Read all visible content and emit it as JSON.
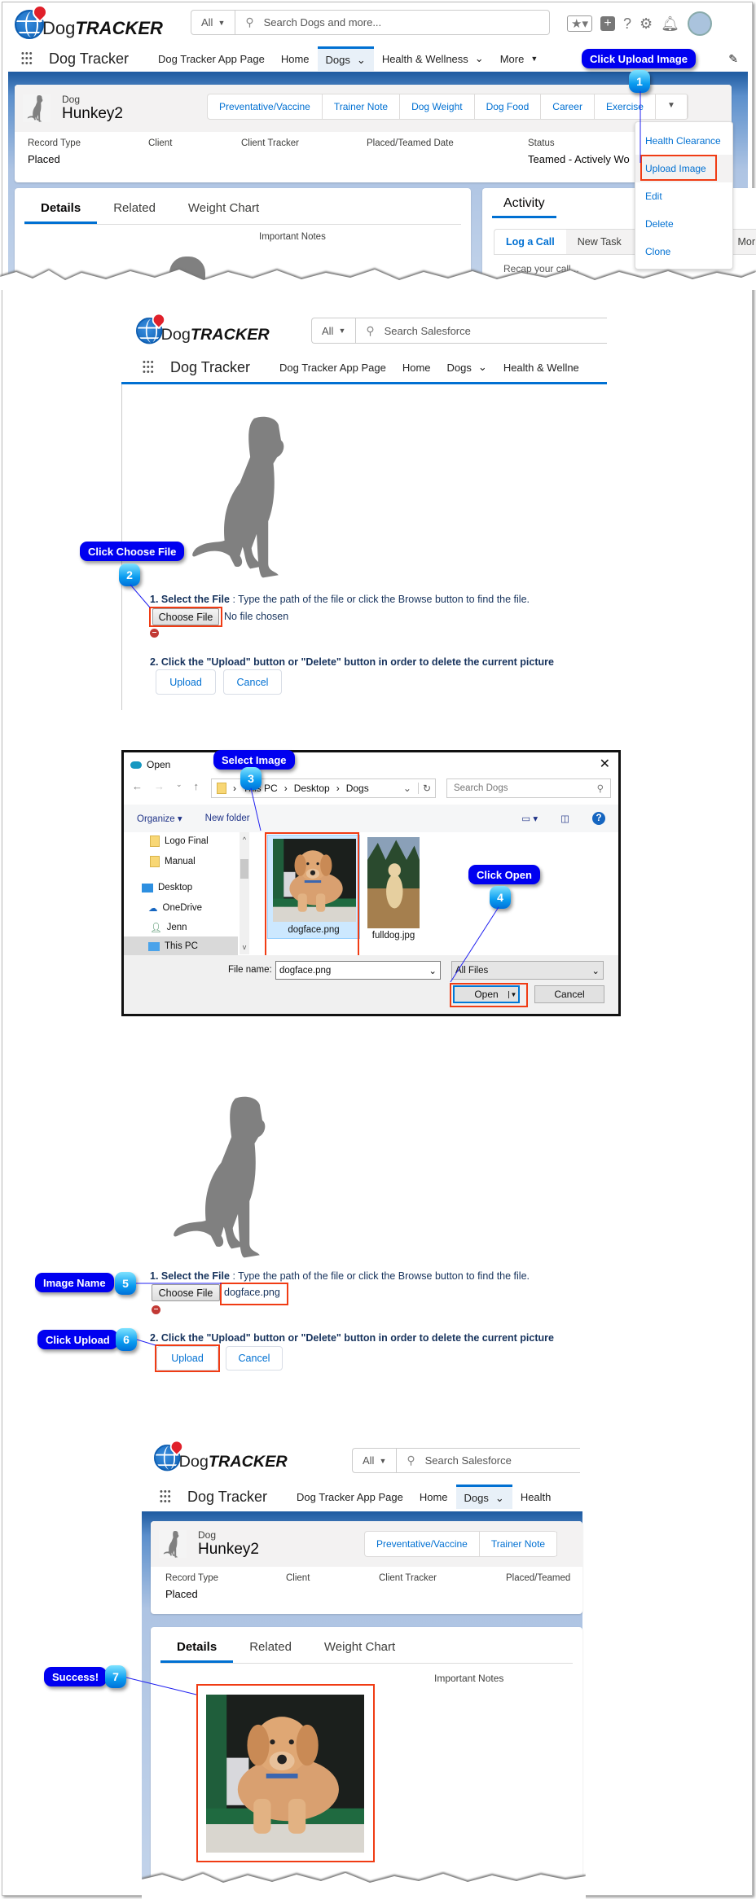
{
  "app": {
    "logo_text_1": "Dog",
    "logo_text_2": "TRACKER",
    "app_name": "Dog Tracker",
    "search_scope": "All",
    "search_placeholder_1": "Search Dogs and more...",
    "search_placeholder_2": "Search Salesforce",
    "nav_items": [
      "Dog Tracker App Page",
      "Home",
      "Dogs",
      "Health & Wellness",
      "More"
    ],
    "nav_item_truncated_2": "Health & Wellne",
    "nav_item_truncated_5": "Health"
  },
  "record": {
    "object_label": "Dog",
    "name": "Hunkey2",
    "actions": [
      "Preventative/Vaccine",
      "Trainer Note",
      "Dog Weight",
      "Dog Food",
      "Career",
      "Exercise"
    ],
    "fields": [
      {
        "label": "Record Type",
        "value": "Placed"
      },
      {
        "label": "Client",
        "value": ""
      },
      {
        "label": "Client Tracker",
        "value": ""
      },
      {
        "label": "Placed/Teamed Date",
        "value": ""
      },
      {
        "label": "Status",
        "value": "Teamed - Actively Wo"
      }
    ],
    "placed_teamed_truncated": "Placed/Teamed",
    "tabs": [
      "Details",
      "Related",
      "Weight Chart"
    ],
    "important_notes": "Important Notes",
    "activity_title": "Activity",
    "activity_tabs": [
      "Log a Call",
      "New Task",
      "Mor"
    ],
    "activity_placeholder": "Recap your call..."
  },
  "dropdown_menu": [
    "Health Clearance",
    "Upload Image",
    "Edit",
    "Delete",
    "Clone"
  ],
  "upload_form": {
    "step1_bold": "1. Select the File",
    "step1_text": " : Type the path of the file or click the Browse button to find the file.",
    "choose_file": "Choose File",
    "no_file": "No file chosen",
    "selected_file": "dogface.png",
    "step2": "2. Click the \"Upload\" button or \"Delete\" button in order to delete the current picture",
    "upload": "Upload",
    "cancel": "Cancel"
  },
  "open_dialog": {
    "title": "Open",
    "path": [
      "This PC",
      "Desktop",
      "Dogs"
    ],
    "search_placeholder": "Search Dogs",
    "organize": "Organize",
    "new_folder": "New folder",
    "nav_items": [
      "Logo Final",
      "Manual",
      "Desktop",
      "OneDrive",
      "Jenn",
      "This PC"
    ],
    "files": [
      "dogface.png",
      "fulldog.jpg"
    ],
    "file_name_label": "File name:",
    "file_name_value": "dogface.png",
    "file_type": "All Files",
    "open": "Open",
    "cancel": "Cancel"
  },
  "callouts": [
    {
      "num": "1",
      "text": "Click Upload Image"
    },
    {
      "num": "2",
      "text": "Click Choose File"
    },
    {
      "num": "3",
      "text": "Select Image"
    },
    {
      "num": "4",
      "text": "Click Open"
    },
    {
      "num": "5",
      "text": "Image Name"
    },
    {
      "num": "6",
      "text": "Click Upload"
    },
    {
      "num": "7",
      "text": "Success!"
    }
  ],
  "colors": {
    "callout": "#0000f0",
    "highlight": "#f03c14",
    "link": "#0070d2",
    "brand_blue": "#1d5aa0"
  }
}
